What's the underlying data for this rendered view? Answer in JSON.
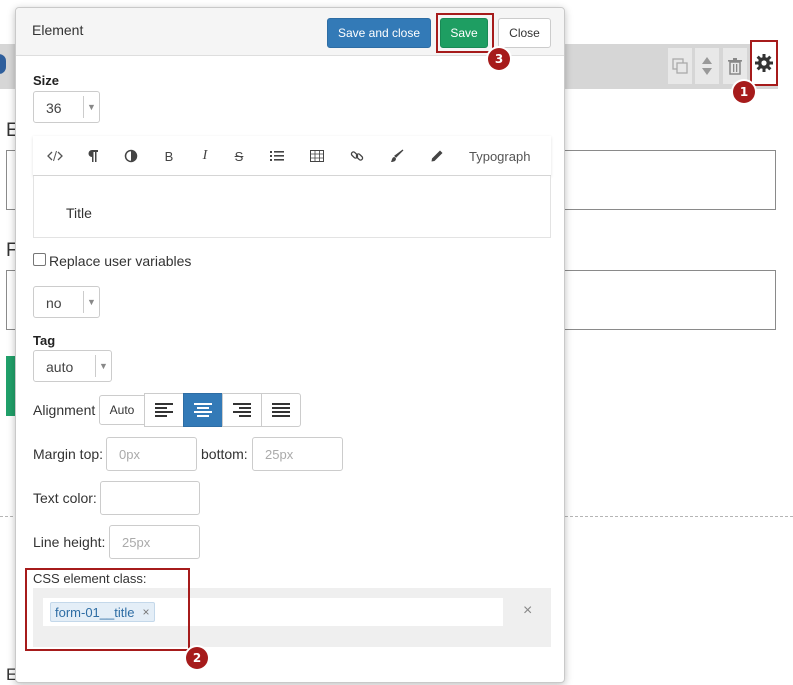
{
  "modal": {
    "title": "Element",
    "save_close_label": "Save and close",
    "save_label": "Save",
    "close_label": "Close"
  },
  "size": {
    "label": "Size",
    "value": "36"
  },
  "editor": {
    "toolbar": [
      "code-icon",
      "paragraph-icon",
      "contrast-icon",
      "bold-icon",
      "italic-icon",
      "strikethrough-icon",
      "list-icon",
      "table-icon",
      "link-icon",
      "brush-icon",
      "pencil-icon"
    ],
    "bold_glyph": "B",
    "italic_glyph": "I",
    "strike_glyph": "S",
    "typograph_label": "Typograph",
    "content": "Title"
  },
  "replace_vars": {
    "label": "Replace user variables",
    "checked": false,
    "select_value": "no"
  },
  "tag": {
    "label": "Tag",
    "value": "auto"
  },
  "alignment": {
    "label": "Alignment",
    "auto_label": "Auto",
    "active": "center"
  },
  "margin": {
    "top_label": "Margin top:",
    "top_placeholder": "0px",
    "bottom_label": "bottom:",
    "bottom_placeholder": "25px"
  },
  "text_color": {
    "label": "Text color:"
  },
  "line_height": {
    "label": "Line height:",
    "placeholder": "25px"
  },
  "css_class": {
    "label": "CSS element class:",
    "tag": "form-01__title",
    "remove_glyph": "×",
    "clear_glyph": "×"
  },
  "badges": [
    "1",
    "2",
    "3"
  ],
  "background": {
    "label_top": "E",
    "label_mid": "F",
    "label_bottom": "E-mail"
  },
  "colors": {
    "primary": "#337ab7",
    "success": "#1e9e62",
    "highlight": "#a61b1b"
  }
}
